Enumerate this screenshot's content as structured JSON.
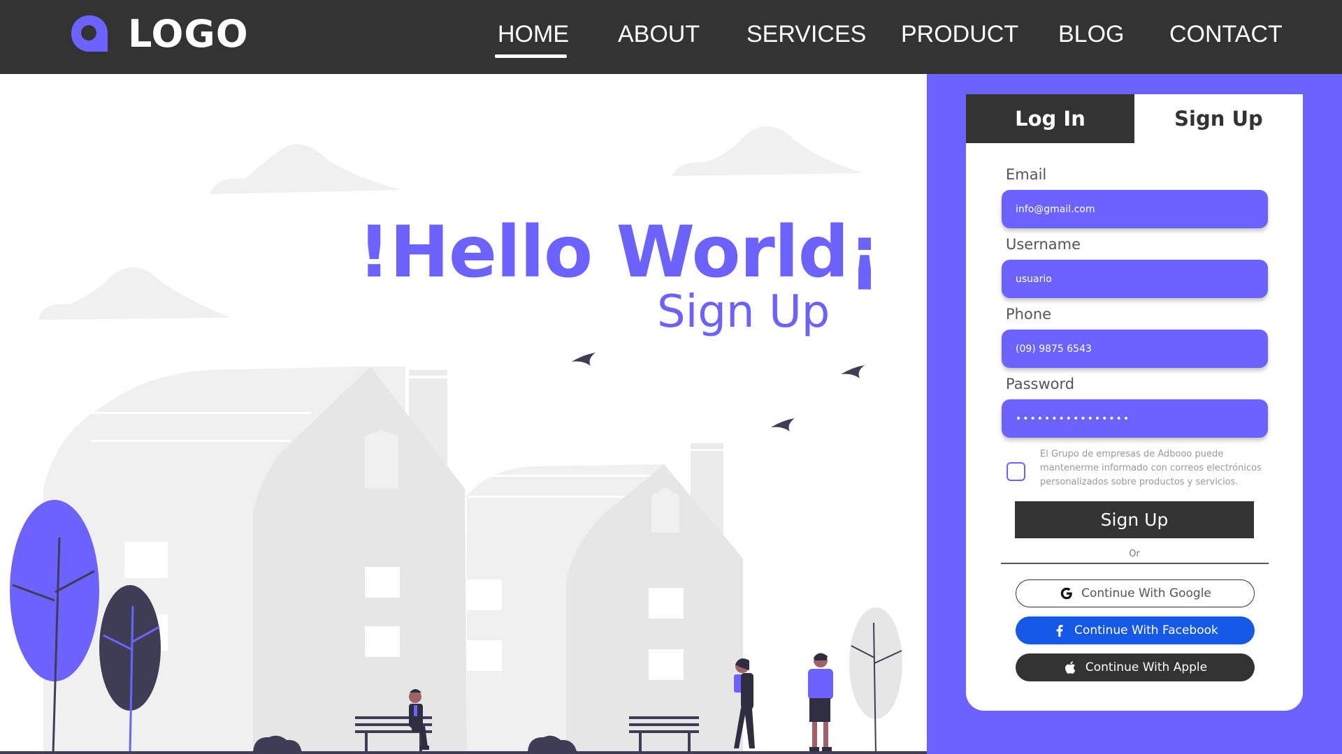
{
  "header": {
    "logo_text": "LOGO",
    "nav": [
      {
        "label": "HOME",
        "active": true
      },
      {
        "label": "ABOUT",
        "active": false
      },
      {
        "label": "SERVICES",
        "active": false
      },
      {
        "label": "PRODUCT",
        "active": false
      },
      {
        "label": "BLOG",
        "active": false
      },
      {
        "label": "CONTACT",
        "active": false
      }
    ]
  },
  "hero": {
    "title": "!Hello World¡",
    "subtitle": "Sign Up"
  },
  "auth": {
    "tabs": [
      {
        "label": "Log In",
        "active": true
      },
      {
        "label": "Sign Up",
        "active": false
      }
    ],
    "fields": [
      {
        "label": "Email",
        "value": "info@gmail.com"
      },
      {
        "label": "Username",
        "value": "usuario"
      },
      {
        "label": "Phone",
        "value": "(09) 9875 6543"
      },
      {
        "label": "Password",
        "value": "••••••••••••••••"
      }
    ],
    "consent_text": "El Grupo de empresas de Adbooo puede mantenerme informado con correos electrónicos personalizados sobre productos y servicios.",
    "consent_checked": false,
    "submit_label": "Sign Up",
    "divider_text": "Or",
    "social": {
      "google": "Continue With Google",
      "facebook": "Continue With Facebook",
      "apple": "Continue With Apple"
    }
  },
  "colors": {
    "accent": "#6c63ff",
    "dark": "#333333",
    "facebook": "#1659e6",
    "building_light": "#f0f0f0",
    "building_mid": "#e6e6e6"
  },
  "icons": [
    "logo-icon",
    "google-icon",
    "facebook-icon",
    "apple-icon"
  ]
}
